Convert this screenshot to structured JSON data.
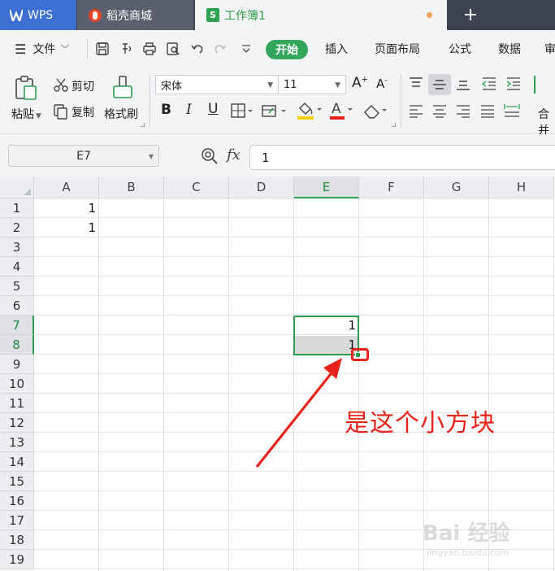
{
  "tabs": [
    {
      "label": "WPS"
    },
    {
      "label": "稻壳商城"
    },
    {
      "label": "工作簿1"
    }
  ],
  "new_tab": "+",
  "menu": {
    "file": "文件",
    "start": "开始",
    "insert": "插入",
    "page_layout": "页面布局",
    "formula": "公式",
    "data": "数据",
    "review": "审"
  },
  "ribbon": {
    "paste": "粘贴",
    "cut": "剪切",
    "copy": "复制",
    "format_painter": "格式刷",
    "font_name": "宋体",
    "font_size": "11",
    "merge": "合并"
  },
  "formula_bar": {
    "cell_ref": "E7",
    "fx": "fx",
    "value": "1"
  },
  "sheet": {
    "columns": [
      "A",
      "B",
      "C",
      "D",
      "E",
      "F",
      "G",
      "H"
    ],
    "rows": [
      "1",
      "2",
      "3",
      "4",
      "5",
      "6",
      "7",
      "8",
      "9",
      "10",
      "11",
      "12",
      "13",
      "14",
      "15",
      "16",
      "17",
      "18",
      "19"
    ],
    "selected_column": "E",
    "selected_rows": [
      "7",
      "8"
    ],
    "cells": [
      {
        "ref": "A1",
        "value": "1"
      },
      {
        "ref": "A2",
        "value": "1"
      },
      {
        "ref": "E7",
        "value": "1"
      },
      {
        "ref": "E8",
        "value": "1"
      }
    ]
  },
  "annotation": {
    "text": "是这个小方块",
    "color": "#e8241a"
  },
  "watermark": {
    "text": "Bai 经验",
    "sub": "jingyan.baidu.com"
  },
  "colors": {
    "accent_green": "#2e9e4f",
    "tab_blue": "#3c71d3",
    "annotation_red": "#e8241a"
  }
}
